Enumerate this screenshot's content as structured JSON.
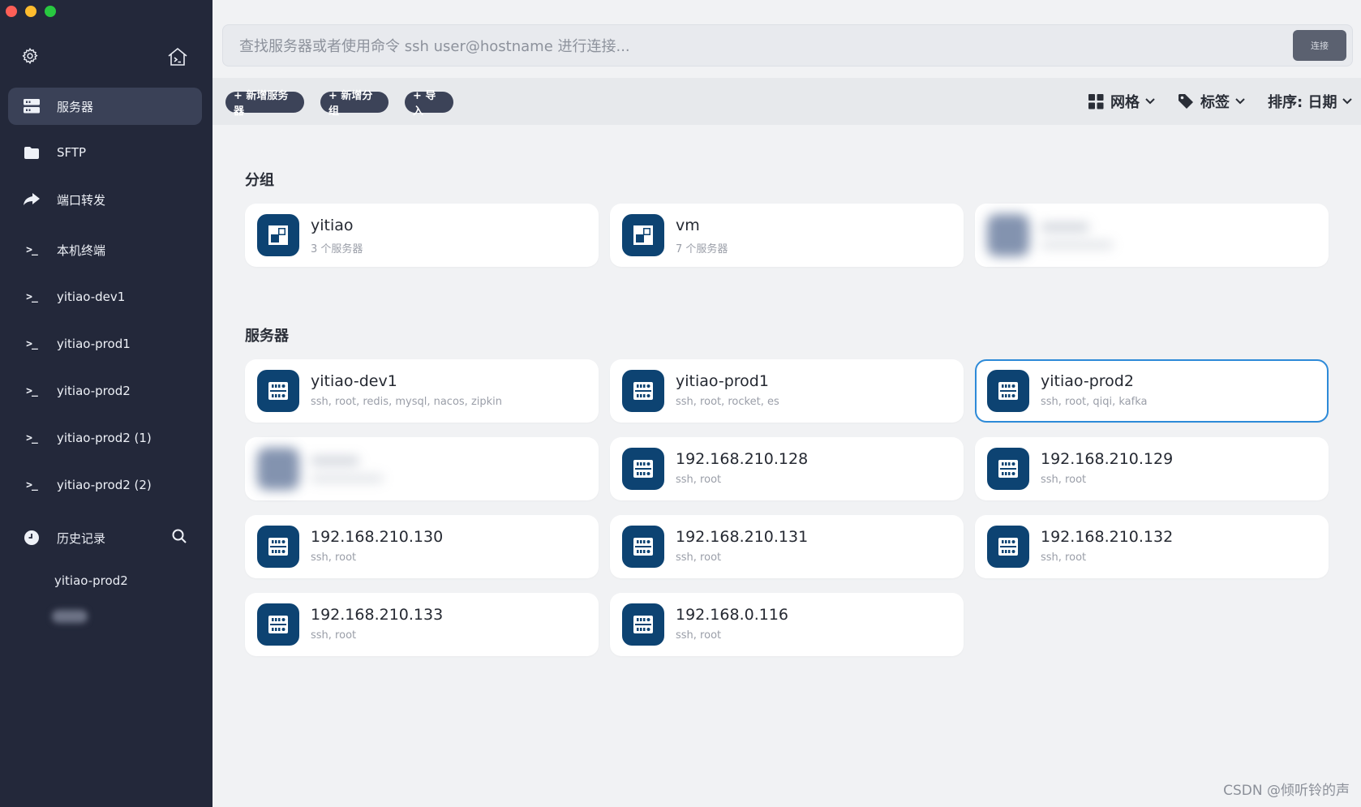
{
  "sidebar": {
    "nav": [
      {
        "label": "服务器",
        "icon": "server-icon",
        "active": true
      },
      {
        "label": "SFTP",
        "icon": "folder-icon",
        "active": false
      },
      {
        "label": "端口转发",
        "icon": "forward-arrow-icon",
        "active": false
      },
      {
        "label": "本机终端",
        "icon": "terminal-icon",
        "active": false
      },
      {
        "label": "yitiao-dev1",
        "icon": "terminal-icon",
        "active": false
      },
      {
        "label": "yitiao-prod1",
        "icon": "terminal-icon",
        "active": false
      },
      {
        "label": "yitiao-prod2",
        "icon": "terminal-icon",
        "active": false
      },
      {
        "label": "yitiao-prod2 (1)",
        "icon": "terminal-icon",
        "active": false
      },
      {
        "label": "yitiao-prod2 (2)",
        "icon": "terminal-icon",
        "active": false
      }
    ],
    "history_label": "历史记录",
    "history_items": [
      "yitiao-prod2"
    ]
  },
  "search": {
    "placeholder": "查找服务器或者使用命令 ssh user@hostname 进行连接...",
    "value": "",
    "connect_label": "连接"
  },
  "toolbar": {
    "new_server": "+ 新增服务器",
    "new_group": "+ 新增分组",
    "import": "+ 导入",
    "view_label": "网格",
    "tags_label": "标签",
    "sort_label": "排序: 日期"
  },
  "groups_title": "分组",
  "groups": [
    {
      "name": "yitiao",
      "sub": "3 个服务器"
    },
    {
      "name": "vm",
      "sub": "7 个服务器"
    }
  ],
  "servers_title": "服务器",
  "servers": [
    {
      "name": "yitiao-dev1",
      "sub": "ssh, root, redis, mysql, nacos, zipkin"
    },
    {
      "name": "yitiao-prod1",
      "sub": "ssh, root, rocket, es"
    },
    {
      "name": "yitiao-prod2",
      "sub": "ssh, root, qiqi, kafka"
    },
    {
      "name": "192.168.210.128",
      "sub": "ssh, root"
    },
    {
      "name": "192.168.210.129",
      "sub": "ssh, root"
    },
    {
      "name": "192.168.210.130",
      "sub": "ssh, root"
    },
    {
      "name": "192.168.210.131",
      "sub": "ssh, root"
    },
    {
      "name": "192.168.210.132",
      "sub": "ssh, root"
    },
    {
      "name": "192.168.210.133",
      "sub": "ssh, root"
    },
    {
      "name": "192.168.0.116",
      "sub": "ssh, root"
    }
  ],
  "colors": {
    "sidebar": "#23283a",
    "tile": "#0d4372",
    "selected_border": "#2d8ad8"
  },
  "watermark": "CSDN @倾听铃的声"
}
